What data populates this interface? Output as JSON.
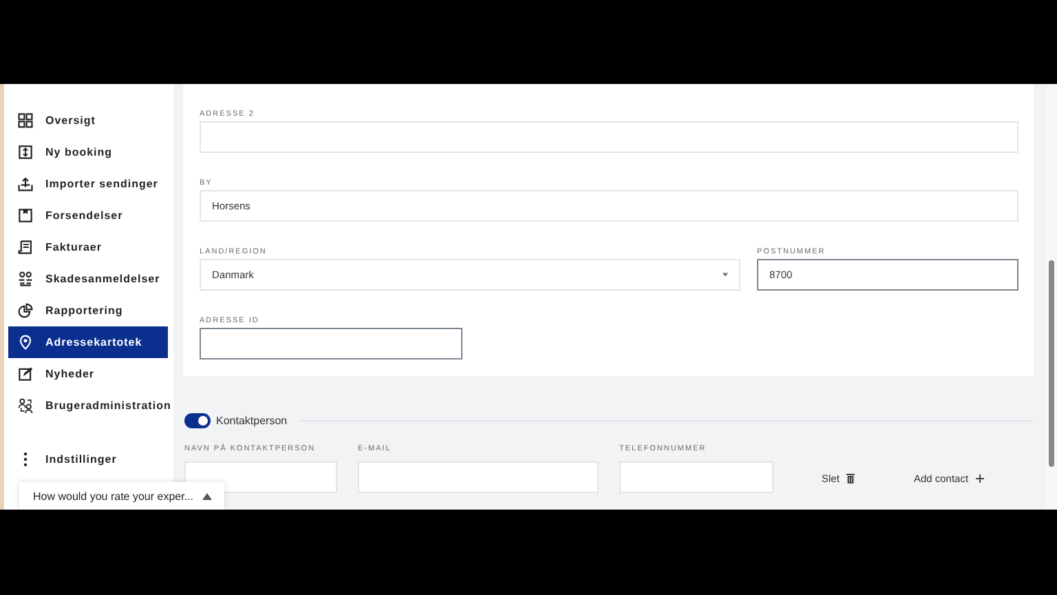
{
  "sidebar": {
    "items": [
      {
        "label": "Oversigt",
        "selected": false
      },
      {
        "label": "Ny booking",
        "selected": false
      },
      {
        "label": "Importer sendinger",
        "selected": false
      },
      {
        "label": "Forsendelser",
        "selected": false
      },
      {
        "label": "Fakturaer",
        "selected": false
      },
      {
        "label": "Skadesanmeldelser",
        "selected": false
      },
      {
        "label": "Rapportering",
        "selected": false
      },
      {
        "label": "Adressekartotek",
        "selected": true
      },
      {
        "label": "Nyheder",
        "selected": false
      },
      {
        "label": "Brugeradministration",
        "selected": false
      }
    ],
    "settings": {
      "label": "Indstillinger"
    }
  },
  "address_form": {
    "rows": [
      [
        {
          "label": "ADRESSE 2",
          "kind": "text",
          "focused": false
        }
      ],
      [
        {
          "label": "BY",
          "kind": "text",
          "value": "Horsens",
          "focused": false
        }
      ],
      [
        {
          "label": "LAND/REGION",
          "kind": "select",
          "value": "Danmark",
          "focused": false
        },
        {
          "label": "POSTNUMMER",
          "kind": "text",
          "value": "8700",
          "focused": true
        }
      ],
      [
        {
          "label": "ADRESSE ID",
          "kind": "text",
          "focused": true
        }
      ]
    ]
  },
  "contact": {
    "toggle": {
      "label": "Kontaktperson",
      "on": true
    },
    "fields": [
      {
        "label": "NAVN PÅ KONTAKTPERSON"
      },
      {
        "label": "E-MAIL"
      },
      {
        "label": "TELEFONNUMMER"
      }
    ],
    "delete_label": "Slet",
    "add_label": "Add contact"
  },
  "feedback": {
    "text": "How would you rate your exper..."
  }
}
